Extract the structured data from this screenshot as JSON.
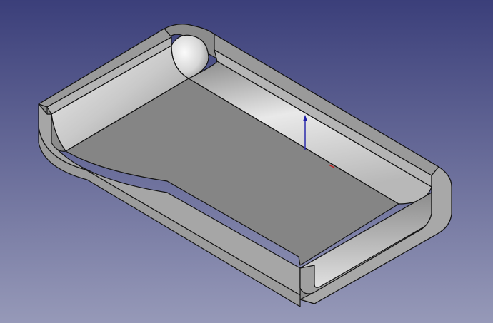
{
  "viewport": {
    "background": {
      "top": "#3b3f7a",
      "bottom": "#9699b8"
    },
    "model": {
      "shape": "rounded-tray",
      "colors": {
        "face": "#8c8c8c",
        "floor": "#858585",
        "side": "#a6a6a6",
        "rim": "#9a9a9a",
        "highlight": "#e4e4e4",
        "edge": "#141414"
      }
    },
    "axes": {
      "z_color": "#1f1fa8",
      "x_color": "#c81e1e"
    }
  }
}
